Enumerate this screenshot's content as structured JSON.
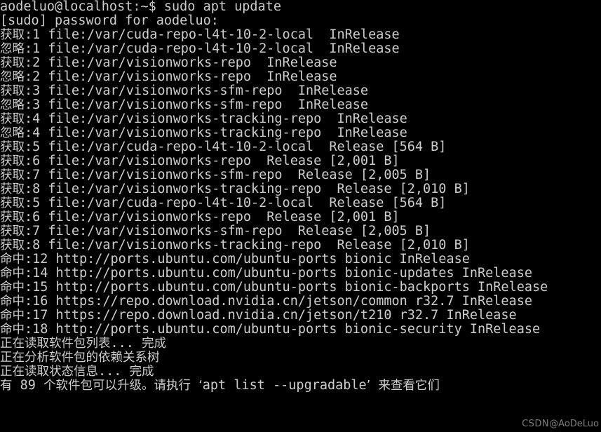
{
  "window": {
    "title": "aodeluo@localhost: ~",
    "background_color": "#000000",
    "text_color": "#cdcdcd",
    "columns": 74,
    "rows": 27
  },
  "prompt": {
    "user": "aodeluo",
    "host": "localhost",
    "cwd": "~",
    "symbol": "$",
    "full": "aodeluo@localhost:~$",
    "command": "sudo apt update"
  },
  "labels": {
    "get": "获取",
    "ignore": "忽略",
    "hit": "命中",
    "release": "Release",
    "inrelease": "InRelease"
  },
  "terminal_lines": [
    "aodeluo@localhost:~$ sudo apt update",
    "[sudo] password for aodeluo:",
    "获取:1 file:/var/cuda-repo-l4t-10-2-local  InRelease",
    "忽略:1 file:/var/cuda-repo-l4t-10-2-local  InRelease",
    "获取:2 file:/var/visionworks-repo  InRelease",
    "忽略:2 file:/var/visionworks-repo  InRelease",
    "获取:3 file:/var/visionworks-sfm-repo  InRelease",
    "忽略:3 file:/var/visionworks-sfm-repo  InRelease",
    "获取:4 file:/var/visionworks-tracking-repo  InRelease",
    "忽略:4 file:/var/visionworks-tracking-repo  InRelease",
    "获取:5 file:/var/cuda-repo-l4t-10-2-local  Release [564 B]",
    "获取:6 file:/var/visionworks-repo  Release [2,001 B]",
    "获取:7 file:/var/visionworks-sfm-repo  Release [2,005 B]",
    "获取:8 file:/var/visionworks-tracking-repo  Release [2,010 B]",
    "获取:5 file:/var/cuda-repo-l4t-10-2-local  Release [564 B]",
    "获取:6 file:/var/visionworks-repo  Release [2,001 B]",
    "获取:7 file:/var/visionworks-sfm-repo  Release [2,005 B]",
    "获取:8 file:/var/visionworks-tracking-repo  Release [2,010 B]",
    "命中:12 http://ports.ubuntu.com/ubuntu-ports bionic InRelease",
    "命中:14 http://ports.ubuntu.com/ubuntu-ports bionic-updates InRelease",
    "命中:15 http://ports.ubuntu.com/ubuntu-ports bionic-backports InRelease",
    "命中:16 https://repo.download.nvidia.cn/jetson/common r32.7 InRelease",
    "命中:17 https://repo.download.nvidia.cn/jetson/t210 r32.7 InRelease",
    "命中:18 http://ports.ubuntu.com/ubuntu-ports bionic-security InRelease",
    "正在读取软件包列表... 完成",
    "正在分析软件包的依赖关系树",
    "正在读取状态信息... 完成",
    "有 89 个软件包可以升级。请执行 ‘apt list --upgradable’ 来查看它们"
  ],
  "apt_summary": {
    "upgradable_count": "89",
    "hint_command": "apt list --upgradable",
    "reading_lists": "正在读取软件包列表... 完成",
    "building_tree": "正在分析软件包的依赖关系树",
    "reading_state": "正在读取状态信息... 完成",
    "upgradable_message": "有 89 个软件包可以升级。请执行 ‘apt list --upgradable’ 来查看它们"
  },
  "repositories": [
    {
      "index": "1",
      "url": "file:/var/cuda-repo-l4t-10-2-local",
      "type": "InRelease",
      "size": ""
    },
    {
      "index": "2",
      "url": "file:/var/visionworks-repo",
      "type": "InRelease",
      "size": ""
    },
    {
      "index": "3",
      "url": "file:/var/visionworks-sfm-repo",
      "type": "InRelease",
      "size": ""
    },
    {
      "index": "4",
      "url": "file:/var/visionworks-tracking-repo",
      "type": "InRelease",
      "size": ""
    },
    {
      "index": "5",
      "url": "file:/var/cuda-repo-l4t-10-2-local",
      "type": "Release",
      "size": "564 B"
    },
    {
      "index": "6",
      "url": "file:/var/visionworks-repo",
      "type": "Release",
      "size": "2,001 B"
    },
    {
      "index": "7",
      "url": "file:/var/visionworks-sfm-repo",
      "type": "Release",
      "size": "2,005 B"
    },
    {
      "index": "8",
      "url": "file:/var/visionworks-tracking-repo",
      "type": "Release",
      "size": "2,010 B"
    },
    {
      "index": "12",
      "url": "http://ports.ubuntu.com/ubuntu-ports",
      "type": "InRelease",
      "suite": "bionic"
    },
    {
      "index": "14",
      "url": "http://ports.ubuntu.com/ubuntu-ports",
      "type": "InRelease",
      "suite": "bionic-updates"
    },
    {
      "index": "15",
      "url": "http://ports.ubuntu.com/ubuntu-ports",
      "type": "InRelease",
      "suite": "bionic-backports"
    },
    {
      "index": "16",
      "url": "https://repo.download.nvidia.cn/jetson/common",
      "type": "InRelease",
      "suite": "r32.7"
    },
    {
      "index": "17",
      "url": "https://repo.download.nvidia.cn/jetson/t210",
      "type": "InRelease",
      "suite": "r32.7"
    },
    {
      "index": "18",
      "url": "http://ports.ubuntu.com/ubuntu-ports",
      "type": "InRelease",
      "suite": "bionic-security"
    }
  ],
  "watermark": {
    "brand": "CSDN",
    "handle": "@AoDeLuo",
    "full": "CSDN @AoDeLuo",
    "color": "#8d8d8d"
  }
}
